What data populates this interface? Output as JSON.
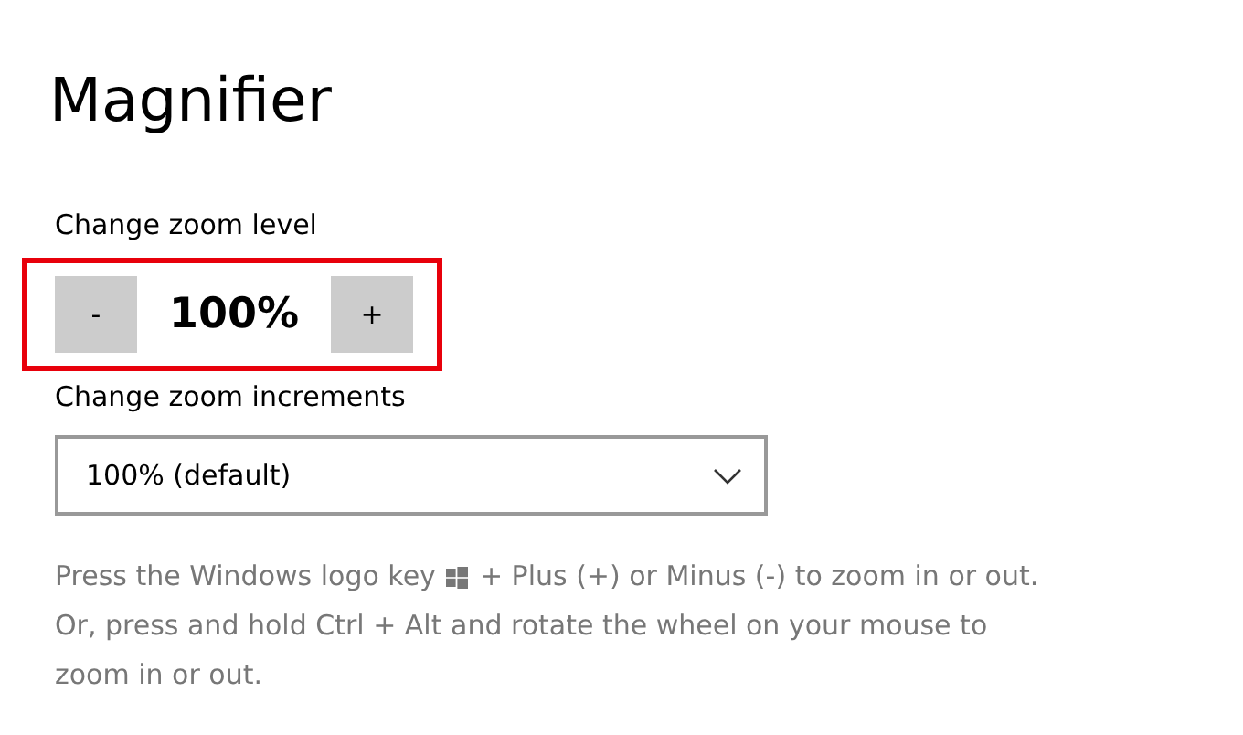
{
  "title": "Magnifier",
  "zoom_level": {
    "label": "Change zoom level",
    "decrease": "-",
    "value": "100%",
    "increase": "+",
    "highlighted": true
  },
  "zoom_increments": {
    "label": "Change zoom increments",
    "value": "100% (default)"
  },
  "help_text_before": "Press the Windows logo key",
  "help_text_after": "+ Plus (+) or Minus (-) to zoom in or out.",
  "help_text_more": "Or, press and hold Ctrl + Alt and rotate the wheel on your mouse to zoom in or out."
}
